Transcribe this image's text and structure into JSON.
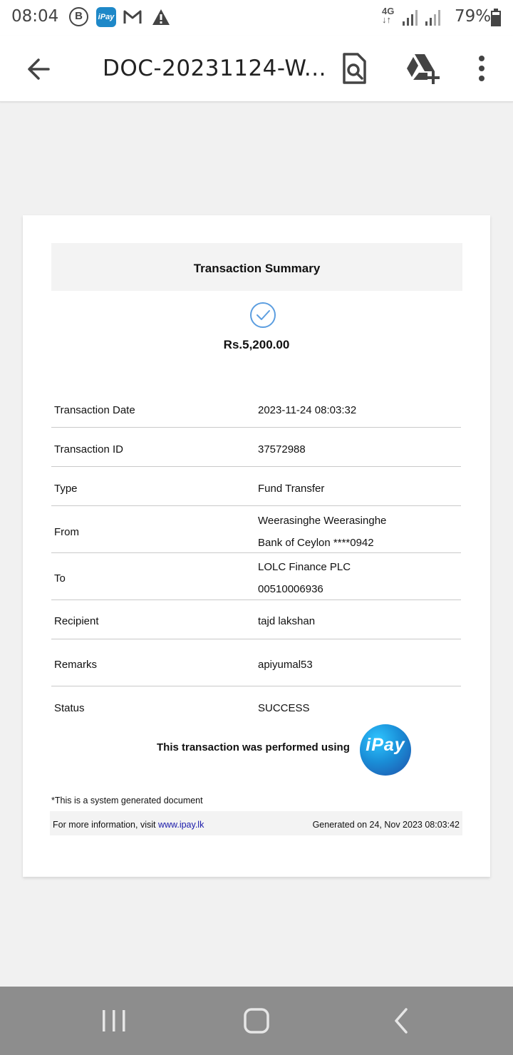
{
  "status_bar": {
    "time": "08:04",
    "network": "4G",
    "battery": "79%"
  },
  "app_bar": {
    "title": "DOC-20231124-W..."
  },
  "document": {
    "header": "Transaction Summary",
    "amount": "Rs.5,200.00",
    "rows": [
      {
        "label": "Transaction Date",
        "value": "2023-11-24 08:03:32"
      },
      {
        "label": "Transaction ID",
        "value": "37572988"
      },
      {
        "label": "Type",
        "value": "Fund Transfer"
      },
      {
        "label": "From",
        "value": "Weerasinghe Weerasinghe",
        "value2": "Bank of Ceylon ****0942"
      },
      {
        "label": "To",
        "value": "LOLC Finance PLC",
        "value2": "00510006936"
      },
      {
        "label": "Recipient",
        "value": "tajd lakshan"
      },
      {
        "label": "Remarks",
        "value": "apiyumal53"
      },
      {
        "label": "Status",
        "value": "SUCCESS"
      }
    ],
    "performed_text": "This transaction was performed using",
    "logo_text": "iPay",
    "system_note": "*This is a system generated document",
    "footer_prefix": "For more information, visit",
    "footer_link": "www.ipay.lk",
    "generated": "Generated on 24, Nov 2023 08:03:42"
  },
  "icons": {
    "status": [
      "b-icon",
      "ipay-icon",
      "gmail-icon",
      "warning-icon",
      "signal-icon",
      "battery-icon"
    ],
    "app_bar": [
      "back-arrow-icon",
      "find-in-page-icon",
      "add-to-drive-icon",
      "more-vert-icon"
    ],
    "nav": [
      "recent-apps-icon",
      "home-icon",
      "back-icon"
    ]
  }
}
